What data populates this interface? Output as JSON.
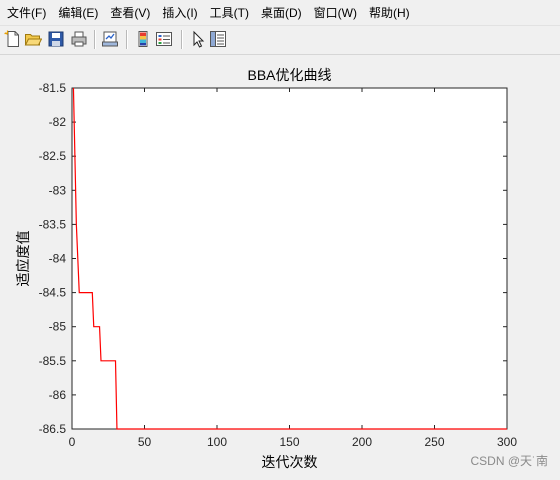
{
  "menu": [
    "文件(F)",
    "编辑(E)",
    "查看(V)",
    "插入(I)",
    "工具(T)",
    "桌面(D)",
    "窗口(W)",
    "帮助(H)"
  ],
  "toolbar": {
    "icons": [
      "new-file-icon",
      "open-folder-icon",
      "save-icon",
      "print-icon",
      "link-plot-icon",
      "colorbar-icon",
      "legend-icon",
      "pointer-icon",
      "property-editor-icon"
    ]
  },
  "watermark": "CSDN @天˙南",
  "chart_data": {
    "type": "line",
    "title": "BBA优化曲线",
    "xlabel": "迭代次数",
    "ylabel": "适应度值",
    "xlim": [
      0,
      300
    ],
    "ylim": [
      -86.5,
      -81.5
    ],
    "xticks": [
      0,
      50,
      100,
      150,
      200,
      250,
      300
    ],
    "xtick_labels": [
      "0",
      "50",
      "100",
      "150",
      "200",
      "250",
      "300"
    ],
    "yticks": [
      -81.5,
      -82,
      -82.5,
      -83,
      -83.5,
      -84,
      -84.5,
      -85,
      -85.5,
      -86,
      -86.5
    ],
    "ytick_labels": [
      "-81.5",
      "-82",
      "-82.5",
      "-83",
      "-83.5",
      "-84",
      "-84.5",
      "-85",
      "-85.5",
      "-86",
      "-86.5"
    ],
    "grid": false,
    "series": [
      {
        "color": "#ff0000",
        "x": [
          1,
          2,
          3,
          4,
          5,
          6,
          7,
          8,
          9,
          10,
          11,
          12,
          13,
          14,
          15,
          16,
          17,
          18,
          19,
          20,
          21,
          22,
          23,
          24,
          25,
          26,
          27,
          28,
          29,
          30,
          31,
          300
        ],
        "y": [
          -81.5,
          -82.5,
          -83.5,
          -84.0,
          -84.5,
          -84.5,
          -84.5,
          -84.5,
          -84.5,
          -84.5,
          -84.5,
          -84.5,
          -84.5,
          -84.5,
          -85.0,
          -85.0,
          -85.0,
          -85.0,
          -85.0,
          -85.5,
          -85.5,
          -85.5,
          -85.5,
          -85.5,
          -85.5,
          -85.5,
          -85.5,
          -85.5,
          -85.5,
          -85.5,
          -86.5,
          -86.5
        ]
      }
    ]
  }
}
